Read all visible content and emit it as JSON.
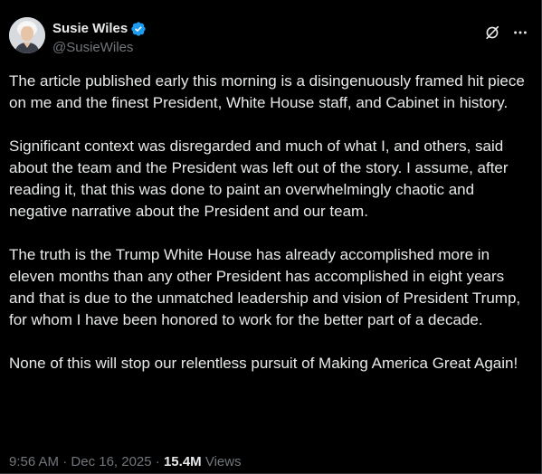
{
  "author": {
    "name": "Susie Wiles",
    "handle": "@SusieWiles"
  },
  "icons": {
    "verified": "verified-badge-icon",
    "grok": "grok-icon",
    "more": "more-icon"
  },
  "colors": {
    "background": "#000000",
    "text": "#e7e9ea",
    "muted": "#71767b",
    "verified": "#1d9bf0"
  },
  "tweet": {
    "paragraphs": [
      "The article published early this morning is a disingenuously framed hit piece on me and the finest President, White House staff, and Cabinet in history.",
      "Significant context was disregarded and much of what I, and others, said about the team and the President was left out of the story. I assume, after reading it, that this was done to paint an overwhelmingly chaotic and negative narrative about the President and our team.",
      "The truth is the Trump White House has already accomplished more in eleven months than any other President has accomplished in eight years and that is due to the unmatched leadership and vision of President Trump, for whom I have been honored to work for the better part of a decade.",
      "None of this will stop our relentless pursuit of Making America Great Again!"
    ]
  },
  "meta": {
    "time": "9:56 AM",
    "separator": " · ",
    "date": "Dec 16, 2025",
    "views_count": "15.4M",
    "views_label": "Views"
  }
}
